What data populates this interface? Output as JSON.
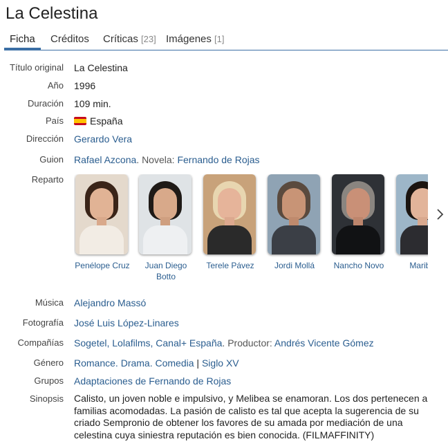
{
  "title": "La Celestina",
  "tabs": [
    {
      "label": "Ficha",
      "count": ""
    },
    {
      "label": "Créditos",
      "count": ""
    },
    {
      "label": "Críticas",
      "count": "[23]"
    },
    {
      "label": "Imágenes",
      "count": "[1]"
    }
  ],
  "fields": {
    "original_title": {
      "label": "Título original",
      "value": "La Celestina"
    },
    "year": {
      "label": "Año",
      "value": "1996"
    },
    "duration": {
      "label": "Duración",
      "value": "109 min."
    },
    "country": {
      "label": "País",
      "value": "España",
      "flag_icon": "spain-flag-icon"
    },
    "direction": {
      "label": "Dirección",
      "value": "Gerardo Vera"
    },
    "script": {
      "label": "Guion",
      "writer": "Rafael Azcona",
      "sep": ". Novela: ",
      "novel": "Fernando de Rojas"
    },
    "cast": {
      "label": "Reparto"
    },
    "music": {
      "label": "Música",
      "value": "Alejandro Massó"
    },
    "photography": {
      "label": "Fotografía",
      "value": "José Luis López-Linares"
    },
    "companies": {
      "label": "Compañías",
      "value": "Sogetel, Lolafilms, Canal+ España",
      "sep": ". Productor: ",
      "producer": "Andrés Vicente Gómez"
    },
    "genre": {
      "label": "Género",
      "g1": "Romance",
      "g2": "Drama",
      "g3": "Comedia",
      "sep": " | ",
      "g4": "Siglo XV"
    },
    "groups": {
      "label": "Grupos",
      "value": "Adaptaciones de Fernando de Rojas"
    },
    "synopsis": {
      "label": "Sinopsis",
      "value": "Calisto, un joven noble e impulsivo, y Melibea se enamoran. Los dos pertenecen a familias acomodadas. La pasión de calisto es tal que acepta la sugerencia de su criado Sempronio de obtener los favores de su amada por mediación de una celestina cuya siniestra reputación es bien conocida. (FILMAFFINITY)"
    }
  },
  "cast": [
    {
      "name": "Penélope Cruz"
    },
    {
      "name": "Juan Diego Botto"
    },
    {
      "name": "Terele Pávez"
    },
    {
      "name": "Jordi Mollá"
    },
    {
      "name": "Nancho Novo"
    },
    {
      "name": "Maribel"
    }
  ],
  "colors": {
    "accent": "#3b6ea5",
    "link": "#2a5d8f"
  },
  "icons": {
    "next": "chevron-right-icon"
  }
}
